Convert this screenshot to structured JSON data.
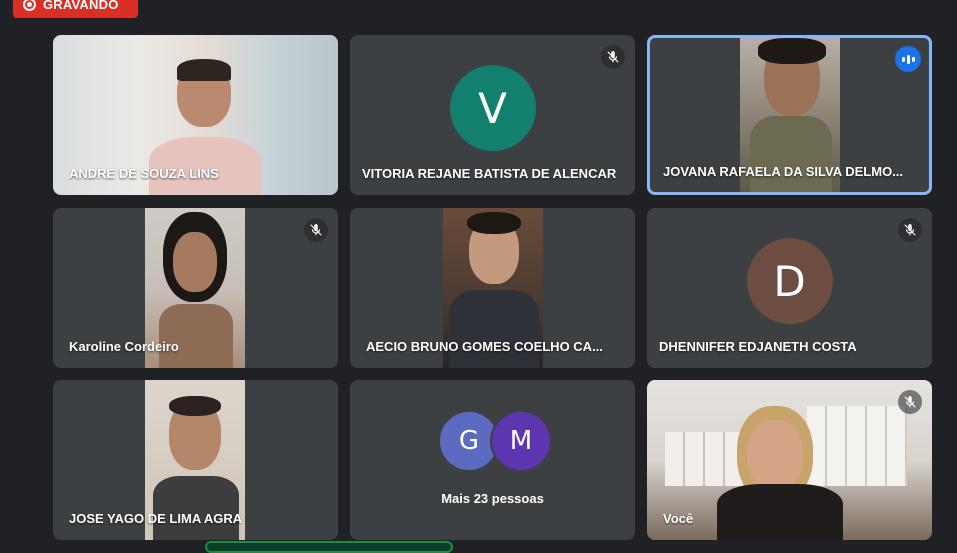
{
  "recording": {
    "label": "GRAVANDO"
  },
  "colors": {
    "background": "#202124",
    "tile": "#3c4043",
    "active_border": "#8ab4f8",
    "recording": "#d93025",
    "speaking": "#1a73e8"
  },
  "participants": [
    {
      "name": "ANDRE DE SOUZA LINS",
      "type": "video",
      "muted": false
    },
    {
      "name": "VITORIA REJANE BATISTA DE ALENCAR",
      "type": "avatar",
      "initial": "V",
      "avatar_color": "#137f6f",
      "muted": true
    },
    {
      "name": "JOVANA RAFAELA DA SILVA DELMO...",
      "type": "video",
      "speaking": true,
      "active": true
    },
    {
      "name": "Karoline Cordeiro",
      "type": "video",
      "muted": true
    },
    {
      "name": "AECIO BRUNO GOMES COELHO CA...",
      "type": "video",
      "muted": false
    },
    {
      "name": "DHENNIFER EDJANETH COSTA",
      "type": "avatar",
      "initial": "D",
      "avatar_color": "#6d4c41",
      "muted": true
    },
    {
      "name": "JOSE YAGO DE LIMA AGRA",
      "type": "video",
      "muted": false
    },
    {
      "name": "Você",
      "type": "video",
      "muted": true
    }
  ],
  "more": {
    "label": "Mais 23 pessoas",
    "avatars": [
      {
        "initial": "G",
        "color": "#5c6bc0"
      },
      {
        "initial": "M",
        "color": "#5e35b1"
      }
    ]
  },
  "icons": {
    "mute": "mic-off-icon",
    "speaking": "audio-level-icon",
    "record": "record-icon"
  }
}
